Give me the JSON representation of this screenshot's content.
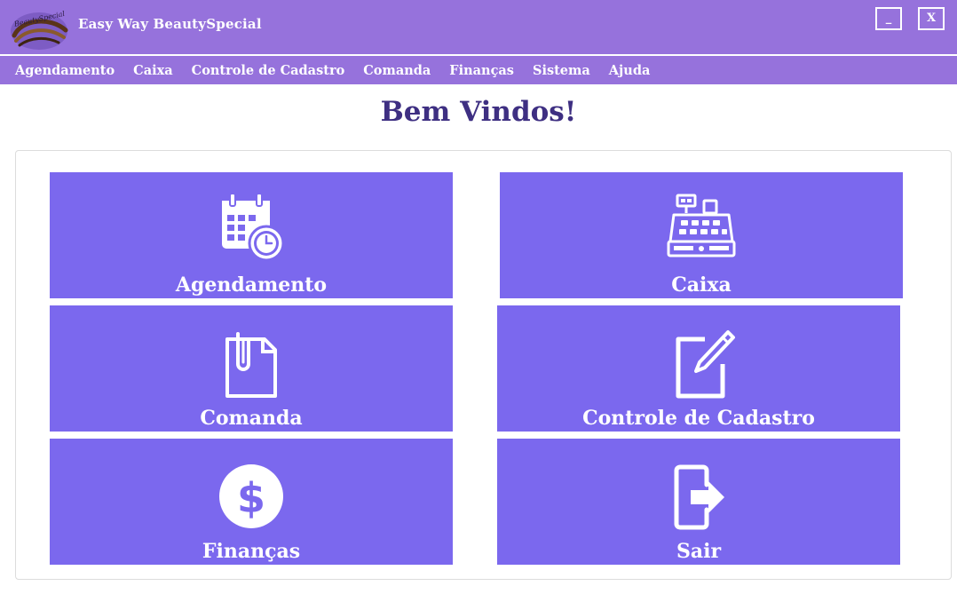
{
  "window": {
    "title": "Easy Way BeautySpecial",
    "logo_text": "BeautySpecial",
    "minimize_label": "_",
    "close_label": "X"
  },
  "menu": {
    "items": [
      {
        "label": "Agendamento"
      },
      {
        "label": "Caixa"
      },
      {
        "label": "Controle de Cadastro"
      },
      {
        "label": "Comanda"
      },
      {
        "label": "Finanças"
      },
      {
        "label": "Sistema"
      },
      {
        "label": "Ajuda"
      }
    ]
  },
  "main": {
    "welcome": "Bem Vindos!",
    "tiles": [
      {
        "label": "Agendamento",
        "icon": "calendar-clock-icon"
      },
      {
        "label": "Caixa",
        "icon": "cash-register-icon"
      },
      {
        "label": "Comanda",
        "icon": "document-clip-icon"
      },
      {
        "label": "Controle de Cadastro",
        "icon": "edit-pen-icon"
      },
      {
        "label": "Finanças",
        "icon": "dollar-icon"
      },
      {
        "label": "Sair",
        "icon": "exit-icon"
      }
    ]
  },
  "colors": {
    "titlebar": "#9672dc",
    "tile": "#7b68ee",
    "heading": "#3e2f82",
    "text_on_accent": "#ffffff"
  }
}
